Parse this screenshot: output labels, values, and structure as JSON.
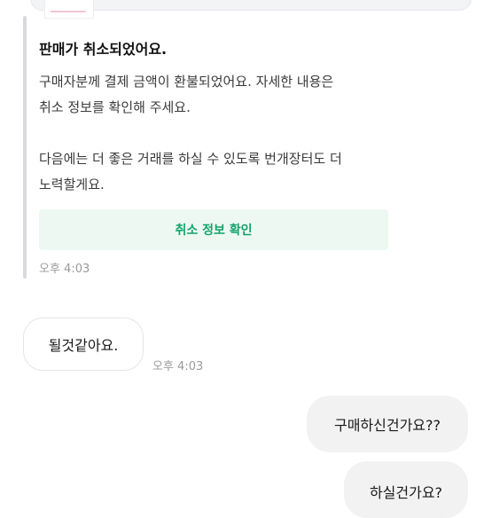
{
  "system_message": {
    "title": "판매가 취소되었어요.",
    "paragraphs": [
      "구매자분께 결제 금액이 환불되었어요. 자세한 내용은\n취소 정보를 확인해 주세요.",
      "다음에는 더 좋은 거래를 하실 수 있도록 번개장터도 더\n노력할게요."
    ],
    "button_label": "취소 정보 확인",
    "time": "오후 4:03"
  },
  "messages": [
    {
      "direction": "incoming",
      "text": "될것같아요.",
      "time": "오후 4:03"
    },
    {
      "direction": "outgoing",
      "text": "구매하신건가요??"
    },
    {
      "direction": "outgoing",
      "text": "하실건가요?"
    }
  ],
  "colors": {
    "accent_green": "#14a36b",
    "button_bg": "#edf8f3",
    "outgoing_bubble": "#f2f2f3",
    "timestamp": "#9a9a9a"
  }
}
